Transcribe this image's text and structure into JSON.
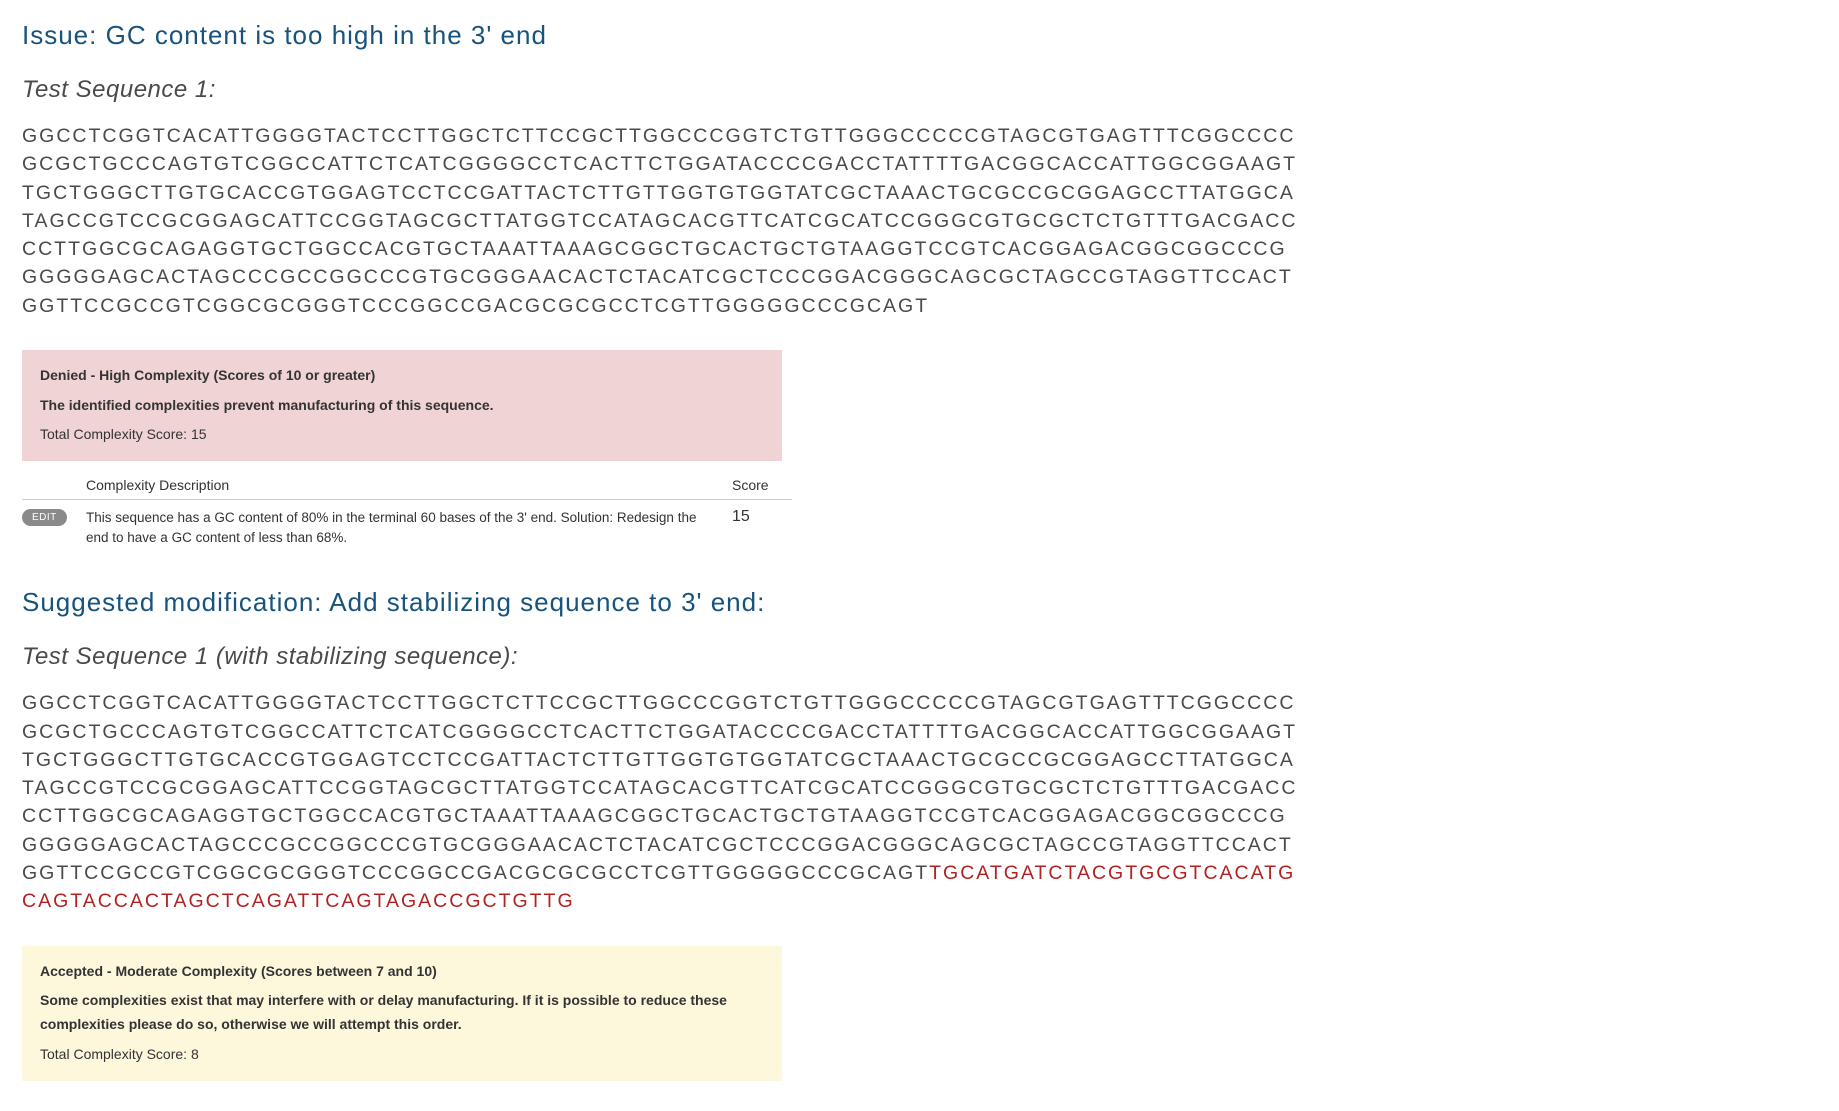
{
  "issue": {
    "heading": "Issue: GC content is too high in the 3' end",
    "sequence_label": "Test Sequence 1:",
    "sequence_text": "GGCCTCGGTCACATTGGGGTACTCCTTGGCTCTTCCGCTTGGCCCGGTCTGTTGGGCCCCCGTAGCGTGAGTTTCGGCCCCGCGCTGCCCAGTGTCGGCCATTCTCATCGGGGCCTCACTTCTGGATACCCCGACCTATTTTGACGGCACCATTGGCGGAAGTTGCTGGGCTTGTGCACCGTGGAGTCCTCCGATTACTCTTGTTGGTGTGGTATCGCTAAACTGCGCCGCGGAGCCTTATGGCATAGCCGTCCGCGGAGCATTCCGGTAGCGCTTATGGTCCATAGCACGTTCATCGCATCCGGGCGTGCGCTCTGTTTGACGACCCCTTGGCGCAGAGGTGCTGGCCACGTGCTAAATTAAAGCGGCTGCACTGCTGTAAGGTCCGTCACGGAGACGGCGGCCCGGGGGGAGCACTAGCCCGCCGGCCCGTGCGGGAACACTCTACATCGCTCCCGGACGGGCAGCGCTAGCCGTAGGTTCCACTGGTTCCGCCGTCGGCGCGGGTCCCGGCCGACGCGCGCCTCGTTGGGGGCCCGCAGT"
  },
  "denied_box": {
    "title": "Denied - High Complexity (Scores of 10 or greater)",
    "desc": "The identified complexities prevent manufacturing of this sequence.",
    "score_line": "Total Complexity Score: 15"
  },
  "complexity_table": {
    "header_desc": "Complexity Description",
    "header_score": "Score",
    "edit_label": "EDIT",
    "row_desc": "This sequence has a GC content of 80% in the terminal 60 bases of the 3' end. Solution: Redesign the end to have a GC content of less than 68%.",
    "row_score": "15"
  },
  "suggestion": {
    "heading": "Suggested modification: Add stabilizing sequence to 3' end:",
    "sequence_label": "Test Sequence 1 (with stabilizing sequence):",
    "sequence_base": "GGCCTCGGTCACATTGGGGTACTCCTTGGCTCTTCCGCTTGGCCCGGTCTGTTGGGCCCCCGTAGCGTGAGTTTCGGCCCCGCGCTGCCCAGTGTCGGCCATTCTCATCGGGGCCTCACTTCTGGATACCCCGACCTATTTTGACGGCACCATTGGCGGAAGTTGCTGGGCTTGTGCACCGTGGAGTCCTCCGATTACTCTTGTTGGTGTGGTATCGCTAAACTGCGCCGCGGAGCCTTATGGCATAGCCGTCCGCGGAGCATTCCGGTAGCGCTTATGGTCCATAGCACGTTCATCGCATCCGGGCGTGCGCTCTGTTTGACGACCCCTTGGCGCAGAGGTGCTGGCCACGTGCTAAATTAAAGCGGCTGCACTGCTGTAAGGTCCGTCACGGAGACGGCGGCCCGGGGGGAGCACTAGCCCGCCGGCCCGTGCGGGAACACTCTACATCGCTCCCGGACGGGCAGCGCTAGCCGTAGGTTCCACTGGTTCCGCCGTCGGCGCGGGTCCCGGCCGACGCGCGCCTCGTTGGGGGCCCGCAGT",
    "sequence_modified": "TGCATGATCTACGTGCGTCACATGCAGTACCACTAGCTCAGATTCAGTAGACCGCTGTTG"
  },
  "accepted_box": {
    "title": "Accepted - Moderate Complexity (Scores between 7 and 10)",
    "desc": "Some complexities exist that may interfere with or delay manufacturing. If it is possible to reduce these complexities please do so, otherwise we will attempt this order.",
    "score_line": "Total Complexity Score: 8"
  }
}
